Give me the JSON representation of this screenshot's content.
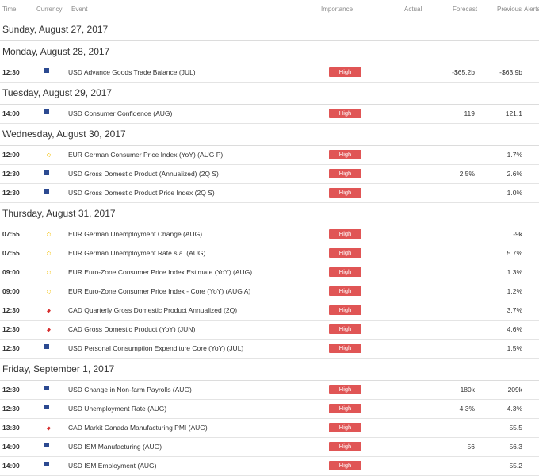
{
  "header": {
    "time": "Time",
    "currency": "Currency",
    "event": "Event",
    "importance": "Importance",
    "actual": "Actual",
    "forecast": "Forecast",
    "previous": "Previous",
    "alerts": "Alerts"
  },
  "days": [
    {
      "date": "Sunday, August 27, 2017",
      "events": []
    },
    {
      "date": "Monday, August 28, 2017",
      "events": [
        {
          "time": "12:30",
          "flag": "us",
          "event": "USD Advance Goods Trade Balance (JUL)",
          "importance": "High",
          "actual": "",
          "forecast": "-$65.2b",
          "previous": "-$63.9b"
        }
      ]
    },
    {
      "date": "Tuesday, August 29, 2017",
      "events": [
        {
          "time": "14:00",
          "flag": "us",
          "event": "USD Consumer Confidence (AUG)",
          "importance": "High",
          "actual": "",
          "forecast": "119",
          "previous": "121.1"
        }
      ]
    },
    {
      "date": "Wednesday, August 30, 2017",
      "events": [
        {
          "time": "12:00",
          "flag": "eu",
          "event": "EUR German Consumer Price Index (YoY) (AUG P)",
          "importance": "High",
          "actual": "",
          "forecast": "",
          "previous": "1.7%"
        },
        {
          "time": "12:30",
          "flag": "us",
          "event": "USD Gross Domestic Product (Annualized) (2Q S)",
          "importance": "High",
          "actual": "",
          "forecast": "2.5%",
          "previous": "2.6%"
        },
        {
          "time": "12:30",
          "flag": "us",
          "event": "USD Gross Domestic Product Price Index (2Q S)",
          "importance": "High",
          "actual": "",
          "forecast": "",
          "previous": "1.0%"
        }
      ]
    },
    {
      "date": "Thursday, August 31, 2017",
      "events": [
        {
          "time": "07:55",
          "flag": "eu",
          "event": "EUR German Unemployment Change (AUG)",
          "importance": "High",
          "actual": "",
          "forecast": "",
          "previous": "-9k"
        },
        {
          "time": "07:55",
          "flag": "eu",
          "event": "EUR German Unemployment Rate s.a. (AUG)",
          "importance": "High",
          "actual": "",
          "forecast": "",
          "previous": "5.7%"
        },
        {
          "time": "09:00",
          "flag": "eu",
          "event": "EUR Euro-Zone Consumer Price Index Estimate (YoY) (AUG)",
          "importance": "High",
          "actual": "",
          "forecast": "",
          "previous": "1.3%"
        },
        {
          "time": "09:00",
          "flag": "eu",
          "event": "EUR Euro-Zone Consumer Price Index - Core (YoY) (AUG A)",
          "importance": "High",
          "actual": "",
          "forecast": "",
          "previous": "1.2%"
        },
        {
          "time": "12:30",
          "flag": "ca",
          "event": "CAD Quarterly Gross Domestic Product Annualized (2Q)",
          "importance": "High",
          "actual": "",
          "forecast": "",
          "previous": "3.7%"
        },
        {
          "time": "12:30",
          "flag": "ca",
          "event": "CAD Gross Domestic Product (YoY) (JUN)",
          "importance": "High",
          "actual": "",
          "forecast": "",
          "previous": "4.6%"
        },
        {
          "time": "12:30",
          "flag": "us",
          "event": "USD Personal Consumption Expenditure Core (YoY) (JUL)",
          "importance": "High",
          "actual": "",
          "forecast": "",
          "previous": "1.5%"
        }
      ]
    },
    {
      "date": "Friday, September 1, 2017",
      "events": [
        {
          "time": "12:30",
          "flag": "us",
          "event": "USD Change in Non-farm Payrolls (AUG)",
          "importance": "High",
          "actual": "",
          "forecast": "180k",
          "previous": "209k"
        },
        {
          "time": "12:30",
          "flag": "us",
          "event": "USD Unemployment Rate (AUG)",
          "importance": "High",
          "actual": "",
          "forecast": "4.3%",
          "previous": "4.3%"
        },
        {
          "time": "13:30",
          "flag": "ca",
          "event": "CAD Markit Canada Manufacturing PMI (AUG)",
          "importance": "High",
          "actual": "",
          "forecast": "",
          "previous": "55.5"
        },
        {
          "time": "14:00",
          "flag": "us",
          "event": "USD ISM Manufacturing (AUG)",
          "importance": "High",
          "actual": "",
          "forecast": "56",
          "previous": "56.3"
        },
        {
          "time": "14:00",
          "flag": "us",
          "event": "USD ISM Employment (AUG)",
          "importance": "High",
          "actual": "",
          "forecast": "",
          "previous": "55.2"
        }
      ]
    }
  ],
  "colors": {
    "high_badge": "#e05555",
    "header_text": "#8a8a8a",
    "row_border": "#e4e4e4"
  },
  "icons": {
    "us": "us-flag-icon",
    "eu": "eu-flag-icon",
    "ca": "canada-flag-icon"
  }
}
